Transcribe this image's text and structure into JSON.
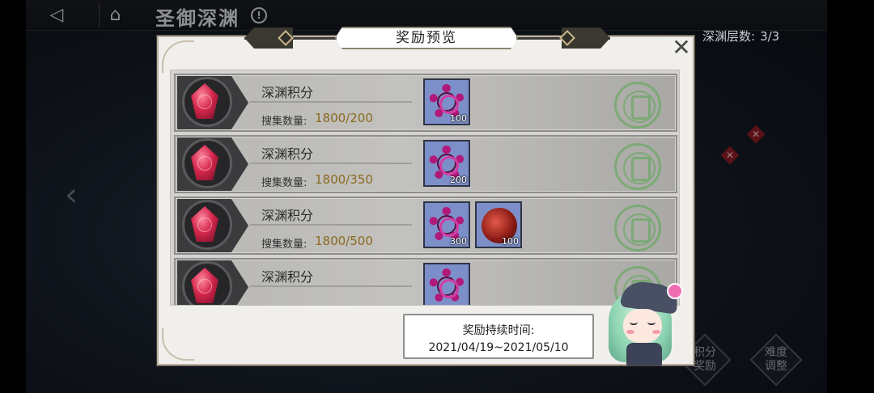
{
  "header": {
    "back_icon": "back-arrow-icon",
    "home_icon": "home-icon",
    "title": "圣御深渊",
    "info_icon": "info-icon",
    "info_glyph": "!"
  },
  "depth": {
    "label": "深渊层数:",
    "value": "3/3"
  },
  "modal": {
    "title": "奖励预览",
    "close_glyph": "✕",
    "rows": [
      {
        "name": "深渊积分",
        "collect_label": "搜集数量:",
        "collect_value": "1800/200",
        "items": [
          {
            "type": "ring",
            "count": "100"
          }
        ]
      },
      {
        "name": "深渊积分",
        "collect_label": "搜集数量:",
        "collect_value": "1800/350",
        "items": [
          {
            "type": "ring",
            "count": "200"
          }
        ]
      },
      {
        "name": "深渊积分",
        "collect_label": "搜集数量:",
        "collect_value": "1800/500",
        "items": [
          {
            "type": "ring",
            "count": "300"
          },
          {
            "type": "red",
            "count": "100"
          }
        ]
      },
      {
        "name": "深渊积分",
        "collect_label": "",
        "collect_value": "",
        "items": [
          {
            "type": "ring",
            "count": ""
          }
        ]
      }
    ],
    "duration": {
      "label": "奖励持续时间:",
      "range": "2021/04/19~2021/05/10"
    }
  },
  "bottom": {
    "buttons": [
      {
        "label": "积分\n奖励"
      },
      {
        "label": "难度\n调整"
      }
    ]
  },
  "colors": {
    "accent_collect": "#8a6a1e",
    "claim_green": "#55a84d",
    "gem_red": "#d3264c",
    "item_bg": "#7c8fc9"
  }
}
